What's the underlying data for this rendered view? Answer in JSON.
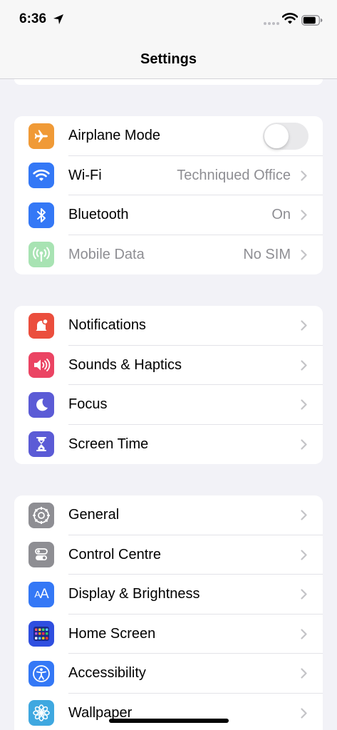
{
  "status": {
    "time": "6:36"
  },
  "nav": {
    "title": "Settings"
  },
  "groups": [
    {
      "rows": [
        {
          "label": "Airplane Mode",
          "icon": "airplane-icon",
          "color": "#f09a37",
          "toggle": false
        },
        {
          "label": "Wi-Fi",
          "value": "Techniqued Office",
          "icon": "wifi-icon",
          "color": "#3478f6"
        },
        {
          "label": "Bluetooth",
          "value": "On",
          "icon": "bluetooth-icon",
          "color": "#3478f6"
        },
        {
          "label": "Mobile Data",
          "value": "No SIM",
          "icon": "antenna-icon",
          "color": "#a8e3b3",
          "disabled": true
        }
      ]
    },
    {
      "rows": [
        {
          "label": "Notifications",
          "icon": "bell-icon",
          "color": "#eb4e3d"
        },
        {
          "label": "Sounds & Haptics",
          "icon": "speaker-icon",
          "color": "#eb4463"
        },
        {
          "label": "Focus",
          "icon": "moon-icon",
          "color": "#5b5bd6"
        },
        {
          "label": "Screen Time",
          "icon": "hourglass-icon",
          "color": "#5b5bd6"
        }
      ]
    },
    {
      "rows": [
        {
          "label": "General",
          "icon": "gear-icon",
          "color": "#8e8e93"
        },
        {
          "label": "Control Centre",
          "icon": "switches-icon",
          "color": "#8e8e93"
        },
        {
          "label": "Display & Brightness",
          "icon": "text-size-icon",
          "color": "#3478f6",
          "glyph": "AA"
        },
        {
          "label": "Home Screen",
          "icon": "app-grid-icon",
          "color": "#2f4fe0"
        },
        {
          "label": "Accessibility",
          "icon": "accessibility-icon",
          "color": "#3478f6"
        },
        {
          "label": "Wallpaper",
          "icon": "flower-icon",
          "color": "#3fa8e0"
        }
      ]
    }
  ]
}
